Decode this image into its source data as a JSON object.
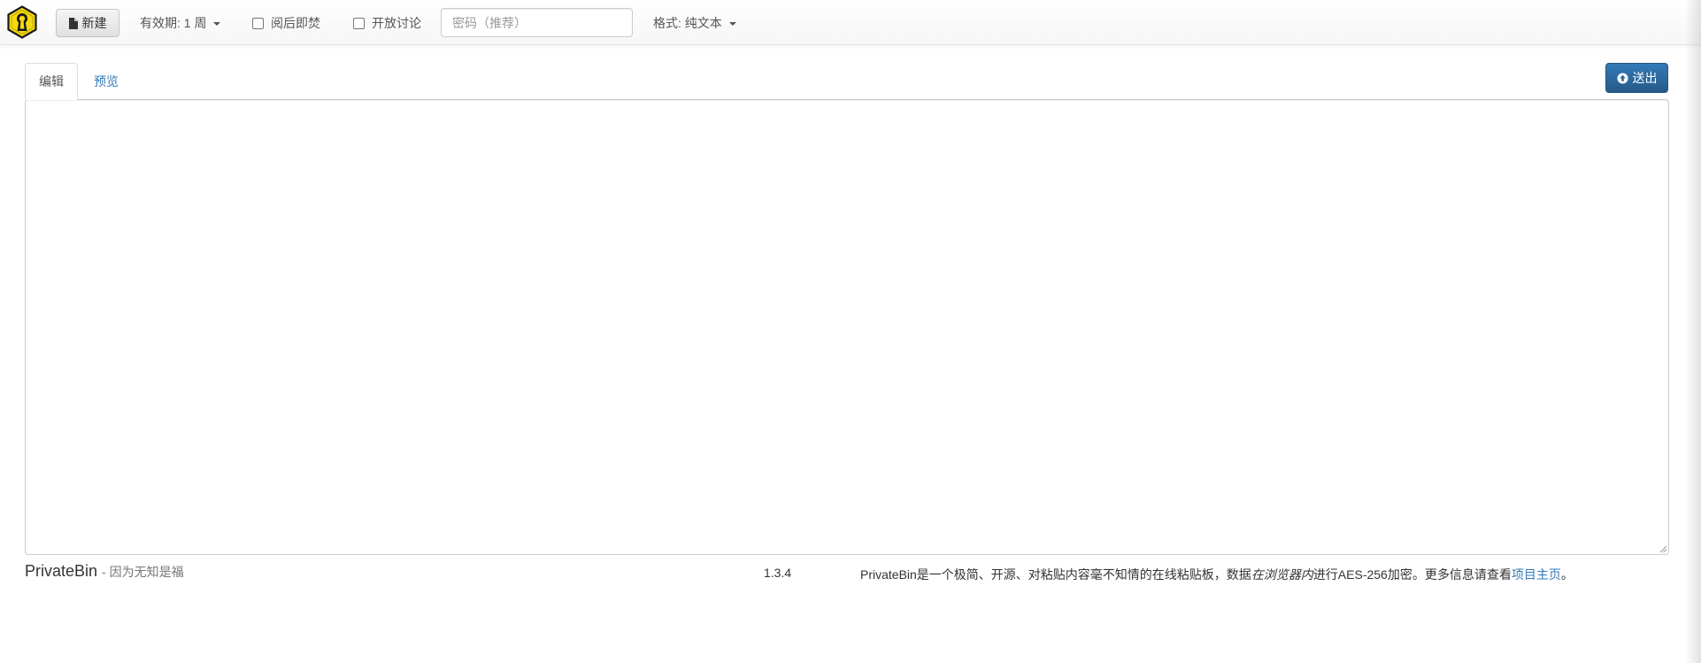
{
  "navbar": {
    "new_button": "新建",
    "expiration": {
      "label": "有效期: 1 周"
    },
    "burn_after_reading": "阅后即焚",
    "open_discussion": "开放讨论",
    "password": {
      "placeholder": "密码（推荐）",
      "value": ""
    },
    "format": {
      "label": "格式: 纯文本"
    }
  },
  "tabs": [
    {
      "label": "编辑",
      "active": true
    },
    {
      "label": "预览",
      "active": false
    }
  ],
  "send_button": "送出",
  "editor": {
    "value": ""
  },
  "footer": {
    "brand": "PrivateBin",
    "slogan": "- 因为无知是福",
    "version": "1.3.4",
    "info_part1": "PrivateBin是一个极简、开源、对粘贴内容毫不知情的在线粘贴板，数据",
    "info_emphasis": "在浏览器内",
    "info_part2": "进行AES-256加密。更多信息请查看",
    "info_link": "项目主页",
    "info_end": "。"
  },
  "colors": {
    "accent": "#337ab7",
    "logo_yellow": "#f5d90f",
    "logo_dark": "#1a1a1a"
  },
  "icons": {
    "logo": "keyhole-logo",
    "new": "file-icon",
    "send": "circle-arrow-up-icon",
    "dropdown": "caret-down-icon"
  }
}
